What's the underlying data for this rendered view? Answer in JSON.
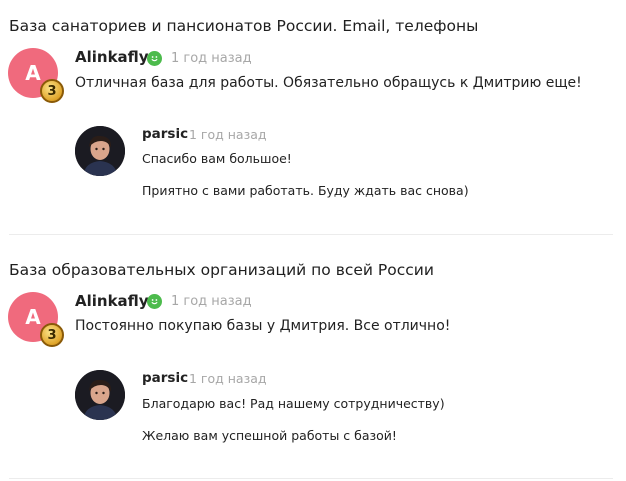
{
  "threads": [
    {
      "title": "База санаториев и пансионатов России. Email, телефоны",
      "comment": {
        "avatar_letter": "A",
        "level": "3",
        "author": "Alinkafly",
        "time": "1 год назад",
        "text": "Отличная база для работы. Обязательно обращусь к Дмитрию еще!"
      },
      "reply": {
        "author": "parsic",
        "time": "1 год назад",
        "lines": [
          "Спасибо вам большое!",
          "Приятно с вами работать. Буду ждать вас снова)"
        ]
      }
    },
    {
      "title": "База образовательных организаций по всей России",
      "comment": {
        "avatar_letter": "A",
        "level": "3",
        "author": "Alinkafly",
        "time": "1 год назад",
        "text": "Постоянно покупаю базы у Дмитрия. Все отлично!"
      },
      "reply": {
        "author": "parsic",
        "time": "1 год назад",
        "lines": [
          "Благодарю вас! Рад нашему сотрудничеству)",
          "Желаю вам успешной работы с базой!"
        ]
      }
    }
  ],
  "colors": {
    "avatar": "#f06a7d",
    "verified": "#4cbb4c",
    "muted_text": "#a7a7a7",
    "badge_gold": "#e0a52a"
  },
  "icons": {
    "verified": "verified-smile-icon",
    "level": "level-badge-icon"
  }
}
